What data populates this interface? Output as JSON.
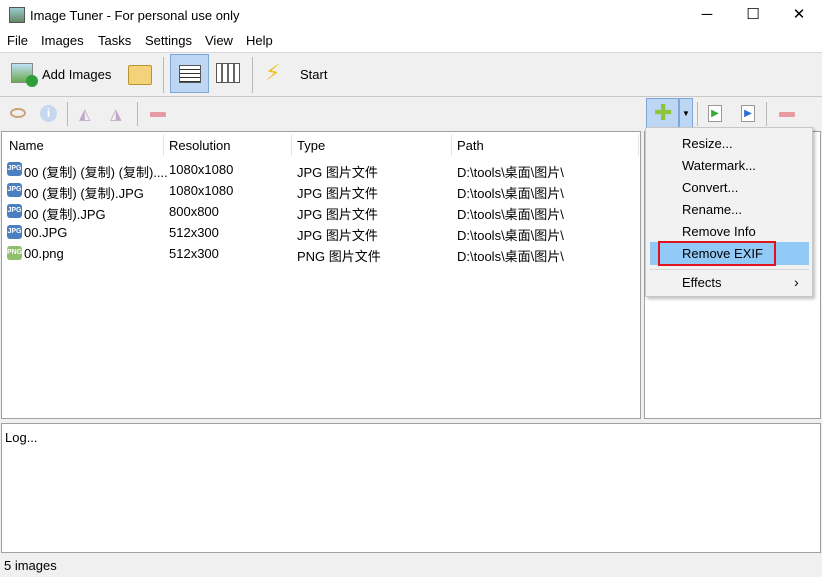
{
  "window": {
    "title": "Image Tuner - For personal use only",
    "minimize": "─",
    "maximize": "☐",
    "close": "✕"
  },
  "menubar": [
    "File",
    "Images",
    "Tasks",
    "Settings",
    "View",
    "Help"
  ],
  "toolbar": {
    "add_images": "Add Images",
    "start": "Start"
  },
  "columns": [
    "Name",
    "Resolution",
    "Type",
    "Path"
  ],
  "files": [
    {
      "name": "00 (复制) (复制) (复制)....",
      "resolution": "1080x1080",
      "type": "JPG 图片文件",
      "path": "D:\\tools\\桌面\\图片\\",
      "icon": "JPG"
    },
    {
      "name": "00 (复制) (复制).JPG",
      "resolution": "1080x1080",
      "type": "JPG 图片文件",
      "path": "D:\\tools\\桌面\\图片\\",
      "icon": "JPG"
    },
    {
      "name": "00 (复制).JPG",
      "resolution": "800x800",
      "type": "JPG 图片文件",
      "path": "D:\\tools\\桌面\\图片\\",
      "icon": "JPG"
    },
    {
      "name": "00.JPG",
      "resolution": "512x300",
      "type": "JPG 图片文件",
      "path": "D:\\tools\\桌面\\图片\\",
      "icon": "JPG"
    },
    {
      "name": "00.png",
      "resolution": "512x300",
      "type": "PNG 图片文件",
      "path": "D:\\tools\\桌面\\图片\\",
      "icon": "PNG"
    }
  ],
  "task_menu": [
    "Resize...",
    "Watermark...",
    "Convert...",
    "Rename...",
    "Remove Info",
    "Remove EXIF"
  ],
  "task_menu_effects": "Effects",
  "task_menu_arrow": "›",
  "log": {
    "label": "Log..."
  },
  "status": {
    "text": "5 images"
  },
  "colors": {
    "highlight": "#91c9f7",
    "red_box": "#e0141e",
    "jpg_icon": "#4a7fc0",
    "png_icon": "#8fbf6a"
  }
}
